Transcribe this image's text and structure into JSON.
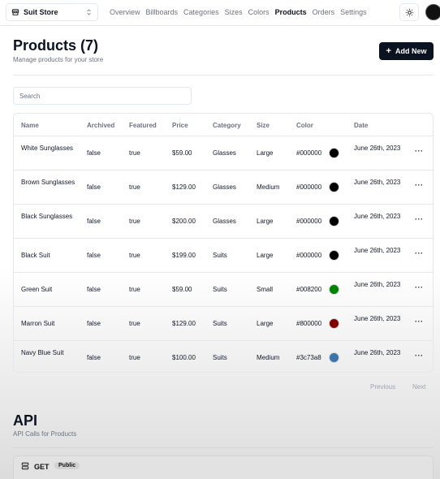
{
  "store_switcher": {
    "label": "Suit Store"
  },
  "nav": [
    "Overview",
    "Billboards",
    "Categories",
    "Sizes",
    "Colors",
    "Products",
    "Orders",
    "Settings"
  ],
  "active_nav": "Products",
  "header": {
    "title": "Products (7)",
    "subtitle": "Manage products for your store",
    "add_label": "Add New"
  },
  "search": {
    "placeholder": "Search",
    "value": ""
  },
  "table": {
    "columns": [
      "Name",
      "Archived",
      "Featured",
      "Price",
      "Category",
      "Size",
      "Color",
      "Date"
    ],
    "rows": [
      {
        "name": "White Sunglasses",
        "archived": "false",
        "featured": "true",
        "price": "$59.00",
        "category": "Glasses",
        "size": "Large",
        "color": "#000000",
        "swatch": "#000000",
        "date": "June 26th, 2023"
      },
      {
        "name": "Brown Sunglasses",
        "archived": "false",
        "featured": "true",
        "price": "$129.00",
        "category": "Glasses",
        "size": "Medium",
        "color": "#000000",
        "swatch": "#000000",
        "date": "June 26th, 2023"
      },
      {
        "name": "Black Sunglasses",
        "archived": "false",
        "featured": "true",
        "price": "$200.00",
        "category": "Glasses",
        "size": "Large",
        "color": "#000000",
        "swatch": "#000000",
        "date": "June 26th, 2023"
      },
      {
        "name": "Black Suit",
        "archived": "false",
        "featured": "true",
        "price": "$199.00",
        "category": "Suits",
        "size": "Large",
        "color": "#000000",
        "swatch": "#000000",
        "date": "June 26th, 2023"
      },
      {
        "name": "Green Suit",
        "archived": "false",
        "featured": "true",
        "price": "$59.00",
        "category": "Suits",
        "size": "Small",
        "color": "#008200",
        "swatch": "#008200",
        "date": "June 26th, 2023"
      },
      {
        "name": "Marron Suit",
        "archived": "false",
        "featured": "true",
        "price": "$129.00",
        "category": "Suits",
        "size": "Large",
        "color": "#800000",
        "swatch": "#800000",
        "date": "June 26th, 2023"
      },
      {
        "name": "Navy Blue Suit",
        "archived": "false",
        "featured": "true",
        "price": "$100.00",
        "category": "Suits",
        "size": "Medium",
        "color": "#3c73a8",
        "swatch": "#3c73a8",
        "date": "June 26th, 2023"
      }
    ],
    "row_action_icon": "more-horizontal-icon"
  },
  "pagination": {
    "previous": "Previous",
    "next": "Next"
  },
  "api": {
    "title": "API",
    "subtitle": "API Calls for Products",
    "method": "GET",
    "badge": "Public"
  },
  "icons": {
    "store": "store-icon",
    "switch": "chevrons-up-down-icon",
    "theme": "sun-icon",
    "server": "server-icon"
  }
}
